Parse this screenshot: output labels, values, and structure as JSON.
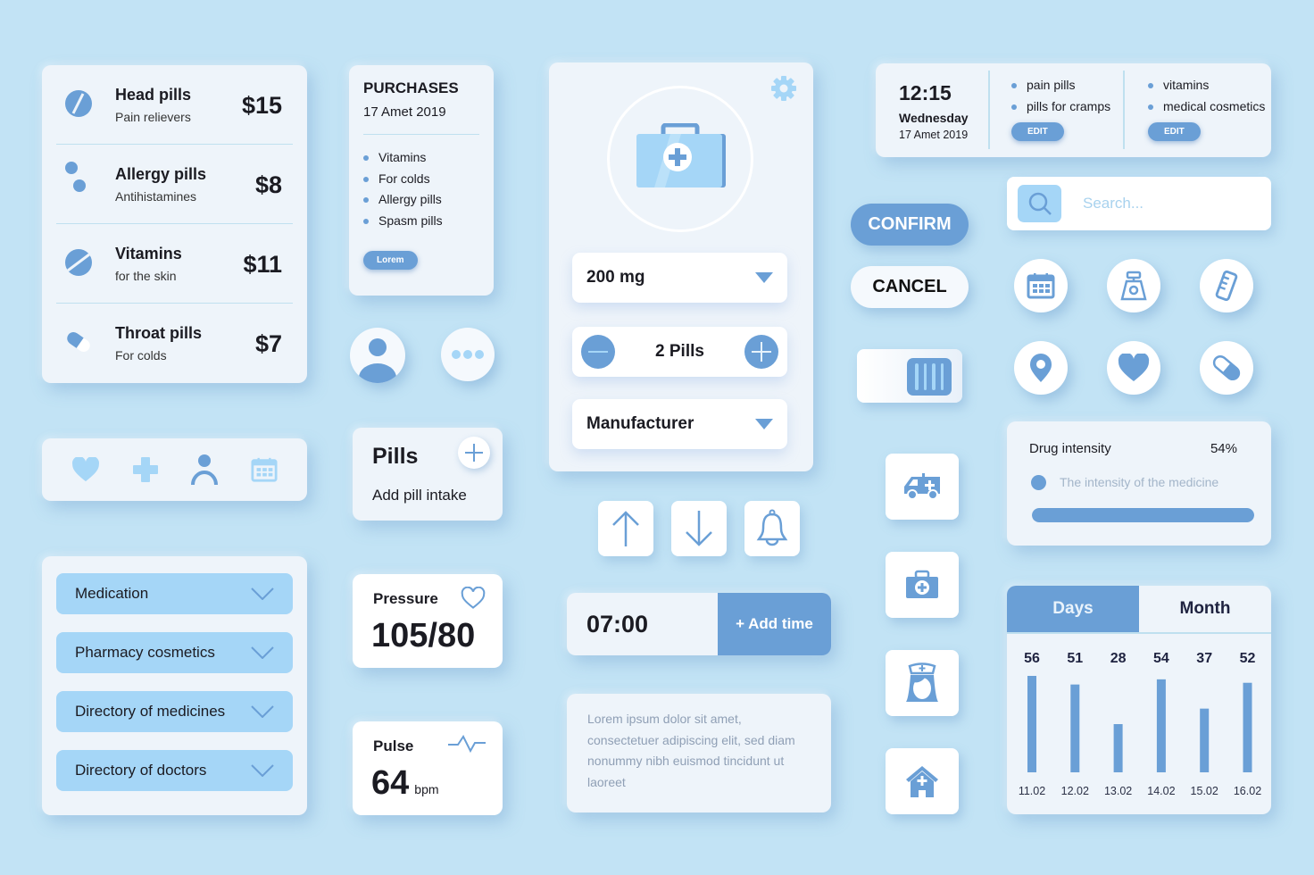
{
  "colors": {
    "background": "#c2e3f5",
    "accent": "#6a9fd6",
    "light_accent": "#a5d6f7",
    "card": "#eef4fa"
  },
  "pill_list": [
    {
      "icon": "round-pill-icon",
      "name": "Head pills",
      "category": "Pain relievers",
      "price": "$15"
    },
    {
      "icon": "small-pills-icon",
      "name": "Allergy pills",
      "category": "Antihistamines",
      "price": "$8"
    },
    {
      "icon": "round-pill-icon",
      "name": "Vitamins",
      "category": "for the skin",
      "price": "$11"
    },
    {
      "icon": "capsule-icon",
      "name": "Throat pills",
      "category": "For colds",
      "price": "$7"
    }
  ],
  "purchases": {
    "title": "PURCHASES",
    "date": "17 Amet 2019",
    "items": [
      "Vitamins",
      "For colds",
      "Allergy pills",
      "Spasm pills"
    ],
    "button_label": "Lorem"
  },
  "config": {
    "dose": "200 mg",
    "quantity": "2 Pills",
    "manufacturer": "Manufacturer"
  },
  "schedule": {
    "time": "12:15",
    "weekday": "Wednesday",
    "date": "17 Amet 2019",
    "columns": [
      {
        "items": [
          "pain pills",
          "pills for cramps"
        ],
        "button_label": "EDIT"
      },
      {
        "items": [
          "vitamins",
          "medical cosmetics"
        ],
        "button_label": "EDIT"
      }
    ]
  },
  "buttons": {
    "confirm": "CONFIRM",
    "cancel": "CANCEL"
  },
  "search": {
    "placeholder": "Search...",
    "value": ""
  },
  "add_pill": {
    "title": "Pills",
    "subtitle": "Add pill intake"
  },
  "menu": [
    "Medication",
    "Pharmacy cosmetics",
    "Directory of medicines",
    "Directory of doctors"
  ],
  "pressure": {
    "label": "Pressure",
    "value": "105/80"
  },
  "pulse": {
    "label": "Pulse",
    "value": "64",
    "unit": "bpm"
  },
  "alarm": {
    "time": "07:00",
    "add_label": "+ Add time"
  },
  "lorem_text": "Lorem ipsum dolor sit amet, consectetuer adipiscing elit, sed diam nonummy nibh euismod tincidunt ut laoreet",
  "intensity": {
    "label": "Drug intensity",
    "percent_label": "54%",
    "percent": 54,
    "description": "The intensity of the medicine"
  },
  "chart_data": {
    "type": "bar",
    "tabs": [
      "Days",
      "Month"
    ],
    "active_tab": "Days",
    "categories": [
      "11.02",
      "12.02",
      "13.02",
      "14.02",
      "15.02",
      "16.02"
    ],
    "values": [
      56,
      51,
      28,
      54,
      37,
      52
    ],
    "ylim": [
      0,
      56
    ],
    "title": "",
    "xlabel": "",
    "ylabel": ""
  }
}
